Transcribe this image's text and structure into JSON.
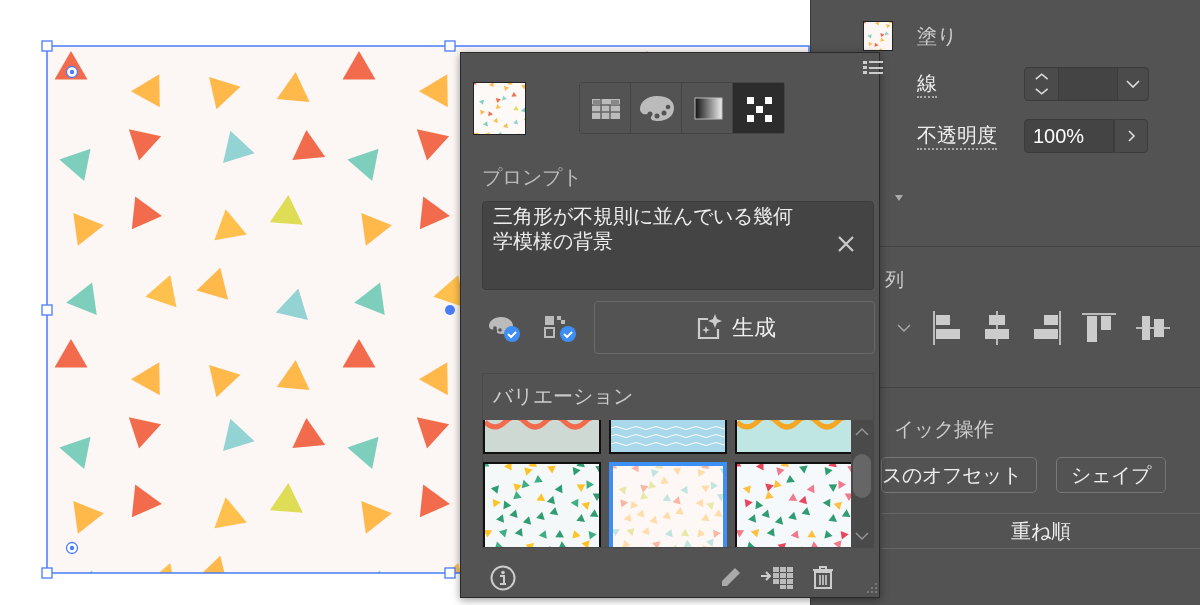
{
  "properties_panel": {
    "fill": {
      "label": "塗り"
    },
    "stroke": {
      "label": "線"
    },
    "opacity": {
      "label": "不透明度",
      "value": "100%"
    },
    "align": {
      "title": "列"
    },
    "quick_actions": {
      "title": "イック操作",
      "buttons": [
        "スのオフセット",
        "シェイプ"
      ]
    },
    "arrange_button": "重ね順"
  },
  "pattern_popup": {
    "fill_tabs": [
      {
        "kind": "swatches",
        "selected": false
      },
      {
        "kind": "palette",
        "selected": false
      },
      {
        "kind": "gradient",
        "selected": false
      },
      {
        "kind": "pattern",
        "selected": true
      }
    ],
    "prompt_label": "プロンプト",
    "prompt_value": "三角形が不規則に並んでいる幾何学模様の背景",
    "toggles": [
      {
        "kind": "color",
        "checked": true
      },
      {
        "kind": "pattern",
        "checked": true
      }
    ],
    "generate_button": "生成",
    "variations_title": "バリエーション",
    "variations": [
      {
        "kind": "peach",
        "selected": false
      },
      {
        "kind": "waves",
        "selected": false
      },
      {
        "kind": "scallop",
        "selected": false
      },
      {
        "kind": "green",
        "selected": false
      },
      {
        "kind": "pastel",
        "selected": true
      },
      {
        "kind": "bright",
        "selected": false
      }
    ]
  }
}
